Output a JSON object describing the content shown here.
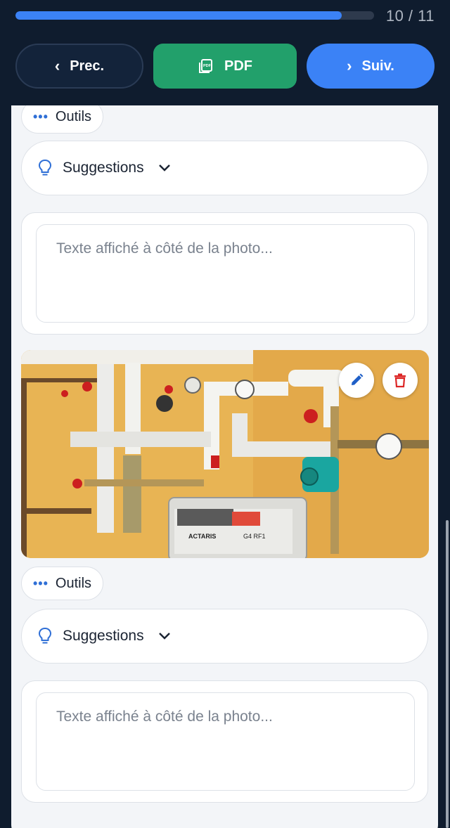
{
  "header": {
    "progress_fraction": 0.91,
    "progress_count": "10 / 11",
    "prev_label": "Prec.",
    "pdf_label": "PDF",
    "next_label": "Suiv."
  },
  "colors": {
    "header_bg": "#0f1c2e",
    "accent_blue": "#3b82f6",
    "pdf_green": "#22a06b",
    "delete_red": "#dc2626"
  },
  "icons": {
    "prev": "chevron-left-icon",
    "pdf": "pdf-document-icon",
    "next": "chevron-right-icon",
    "tools": "more-dots-icon",
    "suggestions": "lightbulb-icon",
    "expand": "chevron-down-icon",
    "edit": "pencil-icon",
    "delete": "trash-icon"
  },
  "sections": [
    {
      "tools_label": "Outils",
      "suggestions_label": "Suggestions",
      "caption_placeholder": "Texte affiché à côté de la photo..."
    },
    {
      "tools_label": "Outils",
      "suggestions_label": "Suggestions",
      "caption_placeholder": "Texte affiché à côté de la photo..."
    }
  ],
  "photo": {
    "meter_brand": "ACTARIS",
    "meter_model": "G4 RF1"
  }
}
